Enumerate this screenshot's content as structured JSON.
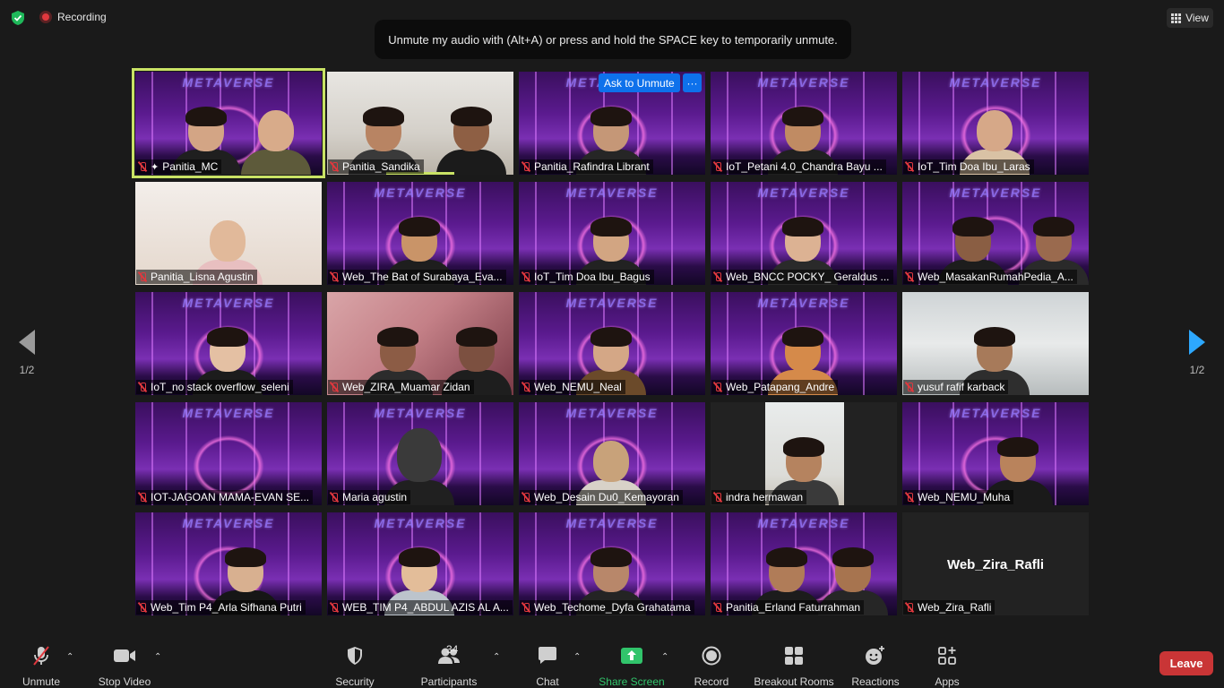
{
  "topbar": {
    "recording_label": "Recording",
    "view_label": "View",
    "toast": "Unmute my audio with (Alt+A) or press and hold the SPACE key to temporarily unmute."
  },
  "pager": {
    "left": "1/2",
    "right": "1/2"
  },
  "tile_overlay": {
    "ask_to_unmute": "Ask to Unmute",
    "more": "···",
    "metaverse_text": "METAVERSE"
  },
  "participants": [
    {
      "name": "Panitia_MC"
    },
    {
      "name": "Panitia_Sandika"
    },
    {
      "name": "Panitia_Rafindra Librant"
    },
    {
      "name": "IoT_Petani 4.0_Chandra Bayu ..."
    },
    {
      "name": "IoT_Tim Doa Ibu_Laras"
    },
    {
      "name": "Panitia_Lisna Agustin"
    },
    {
      "name": "Web_The Bat of Surabaya_Eva..."
    },
    {
      "name": "IoT_Tim Doa Ibu_Bagus"
    },
    {
      "name": "Web_BNCC POCKY_ Geraldus ..."
    },
    {
      "name": "Web_MasakanRumahPedia_A..."
    },
    {
      "name": "IoT_no stack overflow_seleni"
    },
    {
      "name": "Web_ZIRA_Muamar Zidan"
    },
    {
      "name": "Web_NEMU_Neal"
    },
    {
      "name": "Web_Patapang_Andre"
    },
    {
      "name": "yusuf rafif karback"
    },
    {
      "name": "IOT-JAGOAN MAMA-EVAN SE..."
    },
    {
      "name": "Maria agustin"
    },
    {
      "name": "Web_Desain Du0_Kemayoran"
    },
    {
      "name": "indra hermawan"
    },
    {
      "name": "Web_NEMU_Muha"
    },
    {
      "name": "Web_Tim P4_Arla Sifhana Putri"
    },
    {
      "name": "WEB_TIM P4_ABDUL AZIS AL A..."
    },
    {
      "name": "Web_Techome_Dyfa Grahatama"
    },
    {
      "name": "Panitia_Erland Faturrahman"
    },
    {
      "name": "Web_Zira_Rafli",
      "display_text": "Web_Zira_Rafli"
    }
  ],
  "toolbar": {
    "unmute": "Unmute",
    "stop_video": "Stop Video",
    "security": "Security",
    "participants": "Participants",
    "participants_count": "34",
    "chat": "Chat",
    "share_screen": "Share Screen",
    "record": "Record",
    "breakout_rooms": "Breakout Rooms",
    "reactions": "Reactions",
    "apps": "Apps",
    "leave": "Leave"
  },
  "colors": {
    "active_speaker": "#c9e265",
    "share_green": "#31c46b",
    "leave_red": "#c93536",
    "ask_blue": "#0e71eb",
    "mute_red": "#e0383e"
  }
}
